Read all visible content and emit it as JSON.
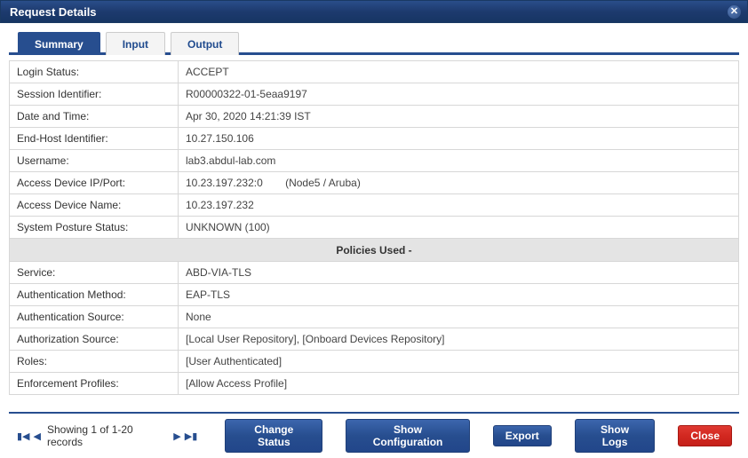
{
  "dialog": {
    "title": "Request Details"
  },
  "tabs": {
    "summary": "Summary",
    "input": "Input",
    "output": "Output"
  },
  "fields": {
    "login_status": {
      "label": "Login Status:",
      "value": "ACCEPT"
    },
    "session_id": {
      "label": "Session Identifier:",
      "value": "R00000322-01-5eaa9197"
    },
    "datetime": {
      "label": "Date and Time:",
      "value": "Apr 30, 2020 14:21:39 IST"
    },
    "end_host": {
      "label": "End-Host Identifier:",
      "value": "10.27.150.106"
    },
    "username": {
      "label": "Username:",
      "value": "lab3.abdul-lab.com"
    },
    "access_ip_port": {
      "label": "Access Device IP/Port:",
      "value": "10.23.197.232:0",
      "extra": "(Node5 / Aruba)"
    },
    "access_name": {
      "label": "Access Device Name:",
      "value": "10.23.197.232"
    },
    "posture": {
      "label": "System Posture Status:",
      "value": "UNKNOWN (100)"
    }
  },
  "section_policies": "Policies Used -",
  "policies": {
    "service": {
      "label": "Service:",
      "value": "ABD-VIA-TLS"
    },
    "auth_method": {
      "label": "Authentication Method:",
      "value": "EAP-TLS"
    },
    "auth_source": {
      "label": "Authentication Source:",
      "value": "None"
    },
    "authz_source": {
      "label": "Authorization Source:",
      "value": "[Local User Repository], [Onboard Devices Repository]"
    },
    "roles": {
      "label": "Roles:",
      "value": "[User Authenticated]"
    },
    "enforcement": {
      "label": "Enforcement Profiles:",
      "value": "[Allow Access Profile]"
    }
  },
  "footer": {
    "pager_text": "Showing 1 of 1-20 records",
    "change_status": "Change Status",
    "show_config": "Show Configuration",
    "export": "Export",
    "show_logs": "Show Logs",
    "close": "Close"
  }
}
